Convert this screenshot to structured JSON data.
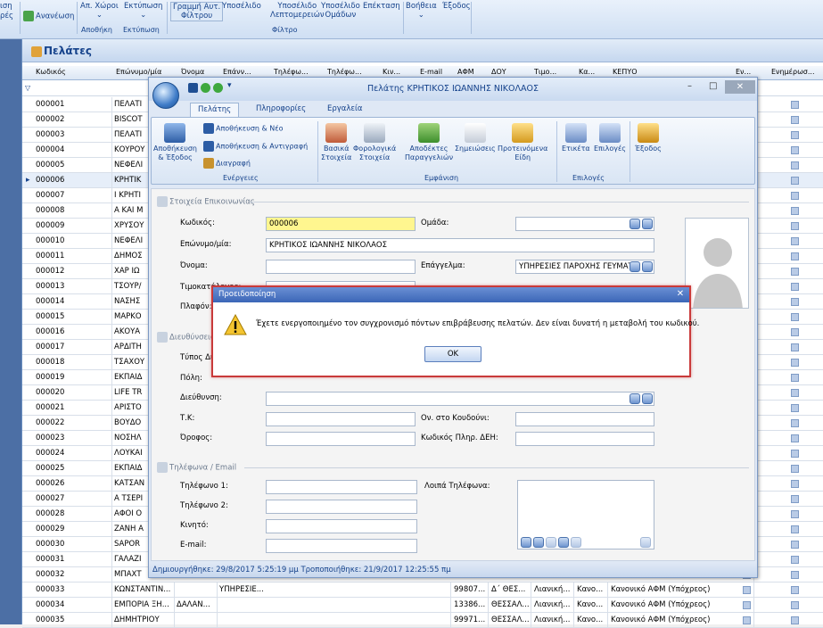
{
  "ribbon": {
    "partial_left_top": "ιση",
    "partial_left_bottom": "ρές",
    "refresh": "Ανανέωση",
    "location": "Απ. Χώροι",
    "print": "Εκτύπωση",
    "filter_line": [
      "Γραμμή Αυτ.",
      "Φίλτρου"
    ],
    "sum": "Υποσέλιδο",
    "sum_details": [
      "Υποσέλιδο",
      "Λεπτομερειών"
    ],
    "sum_groups": [
      "Υποσέλιδο",
      "Ομάδων"
    ],
    "extend": "Επέκταση",
    "help": "Βοήθεια",
    "exit": "Έξοδος",
    "group_store": "Αποθήκη",
    "group_print": "Εκτύπωση",
    "group_filter": "Φίλτρο"
  },
  "main": {
    "title": "Πελάτες",
    "columns": [
      "Κωδικός",
      "Επώνυμο/μία",
      "Όνομα",
      "Επάνν...",
      "Τηλέφω...",
      "Τηλέφω...",
      "Κιν...",
      "E-mail",
      "ΑΦΜ",
      "ΔΟΥ",
      "Τιμο...",
      "Κα...",
      "ΚΕΠΥΟ",
      "Εν...",
      "Ενημέρωσ..."
    ],
    "rows": [
      {
        "code": "000001",
        "name": "ΠΕΛΑΤΙ"
      },
      {
        "code": "000002",
        "name": "BISCOT"
      },
      {
        "code": "000003",
        "name": "ΠΕΛΑΤΙ"
      },
      {
        "code": "000004",
        "name": "ΚΟΥΡΟΥ"
      },
      {
        "code": "000005",
        "name": "ΝΕΦΕΛΙ"
      },
      {
        "code": "000006",
        "name": "ΚΡΗΤΙΚ"
      },
      {
        "code": "000007",
        "name": "Ι ΚΡΗΤΙ"
      },
      {
        "code": "000008",
        "name": "Α ΚΑΙ Μ"
      },
      {
        "code": "000009",
        "name": "ΧΡΥΣΟΥ"
      },
      {
        "code": "000010",
        "name": "ΝΕΦΕΛΙ"
      },
      {
        "code": "000011",
        "name": "ΔΗΜΟΣ"
      },
      {
        "code": "000012",
        "name": "ΧΑΡ ΙΩ"
      },
      {
        "code": "000013",
        "name": "ΤΣΟΥΡ/"
      },
      {
        "code": "000014",
        "name": "ΝΑΣΗΣ"
      },
      {
        "code": "000015",
        "name": "ΜΑΡΚΟ"
      },
      {
        "code": "000016",
        "name": "ΑΚΟΥΑ"
      },
      {
        "code": "000017",
        "name": "ΑΡΔΙΤΗ"
      },
      {
        "code": "000018",
        "name": "ΤΣΑΧΟΥ"
      },
      {
        "code": "000019",
        "name": "ΕΚΠΑΙΔ"
      },
      {
        "code": "000020",
        "name": "LIFE TR"
      },
      {
        "code": "000021",
        "name": "ΑΡΙΣΤΟ"
      },
      {
        "code": "000022",
        "name": "ΒΟΥΔΟ"
      },
      {
        "code": "000023",
        "name": "ΝΟΣΗΛ"
      },
      {
        "code": "000024",
        "name": "ΛΟΥΚΑΙ"
      },
      {
        "code": "000025",
        "name": "ΕΚΠΑΙΔ"
      },
      {
        "code": "000026",
        "name": "ΚΑΤΣΑΝ"
      },
      {
        "code": "000027",
        "name": "Α ΤΣΕΡΙ"
      },
      {
        "code": "000028",
        "name": "ΑΦΟΙ Ο"
      },
      {
        "code": "000029",
        "name": "ΖΑΝΗ Α"
      },
      {
        "code": "000030",
        "name": "SAPOR"
      },
      {
        "code": "000031",
        "name": "ΓΑΛΑΖΙ"
      },
      {
        "code": "000032",
        "name": "ΜΠΑΧΤ"
      }
    ],
    "full_rows": [
      {
        "code": "000033",
        "name": "ΚΩΝΣΤΑΝΤΙΝ...",
        "first": "",
        "prof": "ΥΠΗΡΕΣΙΕ...",
        "afm": "99807...",
        "doy": "Δ΄ ΘΕΣ...",
        "tim": "Λιανική...",
        "cat": "Κανο...",
        "kepyo": "Κανονικό ΑΦΜ (Υπόχρεος)"
      },
      {
        "code": "000034",
        "name": "ΕΜΠΟΡΙΑ ΞΗ...",
        "first": "ΔΑΛΑΝ...",
        "prof": "",
        "afm": "13386...",
        "doy": "ΘΕΣΣΑΛ...",
        "tim": "Λιανική...",
        "cat": "Κανο...",
        "kepyo": "Κανονικό ΑΦΜ (Υπόχρεος)"
      },
      {
        "code": "000035",
        "name": "ΔΗΜΗΤΡΙΟΥ",
        "first": "",
        "prof": "",
        "afm": "99971...",
        "doy": "ΘΕΣΣΑΛ...",
        "tim": "Λιανική...",
        "cat": "Κανο...",
        "kepyo": "Κανονικό ΑΦΜ (Υπόχρεος)"
      }
    ]
  },
  "dialog": {
    "title": "Πελάτης ΚΡΗΤΙΚΟΣ ΙΩΑΝΝΗΣ ΝΙΚΟΛΑΟΣ",
    "tabs": [
      "Πελάτης",
      "Πληροφορίες",
      "Εργαλεία"
    ],
    "save_close": [
      "Αποθήκευση",
      "& Έξοδος"
    ],
    "save_new": "Αποθήκευση & Νέο",
    "save_copy": "Αποθήκευση & Αντιγραφή",
    "delete": "Διαγραφή",
    "group_actions": "Ενέργειες",
    "basic": [
      "Βασικά",
      "Στοιχεία"
    ],
    "tax": [
      "Φορολογικά",
      "Στοιχεία"
    ],
    "orders": [
      "Αποδέκτες",
      "Παραγγελιών"
    ],
    "notes": "Σημειώσεις",
    "suggested": [
      "Προτεινόμενα",
      "Είδη"
    ],
    "group_view": "Εμφάνιση",
    "labels": "Ετικέτα",
    "options": "Επιλογές",
    "group_options": "Επιλογές",
    "exit": "Έξοδος",
    "status": "Δημιουργήθηκε: 29/8/2017 5:25:19 μμ   Τροποποιήθηκε: 21/9/2017 12:25:55 πμ"
  },
  "form": {
    "contact_section": "Στοιχεία Επικοινωνίας",
    "code_label": "Κωδικός:",
    "code_value": "000006",
    "group_label": "Ομάδα:",
    "surname_label": "Επώνυμο/μία:",
    "surname_value": "ΚΡΗΤΙΚΟΣ ΙΩΑΝΝΗΣ ΝΙΚΟΛΑΟΣ",
    "firstname_label": "Όνομα:",
    "profession_label": "Επάγγελμα:",
    "profession_value": "ΥΠΗΡΕΣΙΕΣ ΠΑΡΟΧΗΣ ΓΕΥΜΑΤ",
    "pricelist_label": "Τιμοκατάλογος:",
    "ceiling_label": "Πλαφόν:",
    "address_section": "Διευθύνσεις",
    "type_label": "Τύπος Διε",
    "city_label": "Πόλη:",
    "address_label": "Διεύθυνση:",
    "zip_label": "Τ.Κ:",
    "doorbell_label": "Ον. στο Κουδούνι:",
    "floor_label": "Όροφος:",
    "dei_label": "Κωδικός Πληρ. ΔΕΗ:",
    "phones_section": "Τηλέφωνα / Email",
    "phone1_label": "Τηλέφωνο 1:",
    "phone2_label": "Τηλέφωνο 2:",
    "mobile_label": "Κινητό:",
    "email_label": "E-mail:",
    "other_phones_label": "Λοιπά Τηλέφωνα:"
  },
  "warning": {
    "title": "Προειδοποίηση",
    "message": "Έχετε ενεργοποιημένο τον συγχρονισμό πόντων επιβράβευσης πελατών. Δεν είναι δυνατή η μεταβολή του κωδικού.",
    "ok": "OK"
  },
  "colors": {
    "accent": "#15428b",
    "warning_border": "#c93a3a",
    "code_highlight": "#fff68f"
  }
}
